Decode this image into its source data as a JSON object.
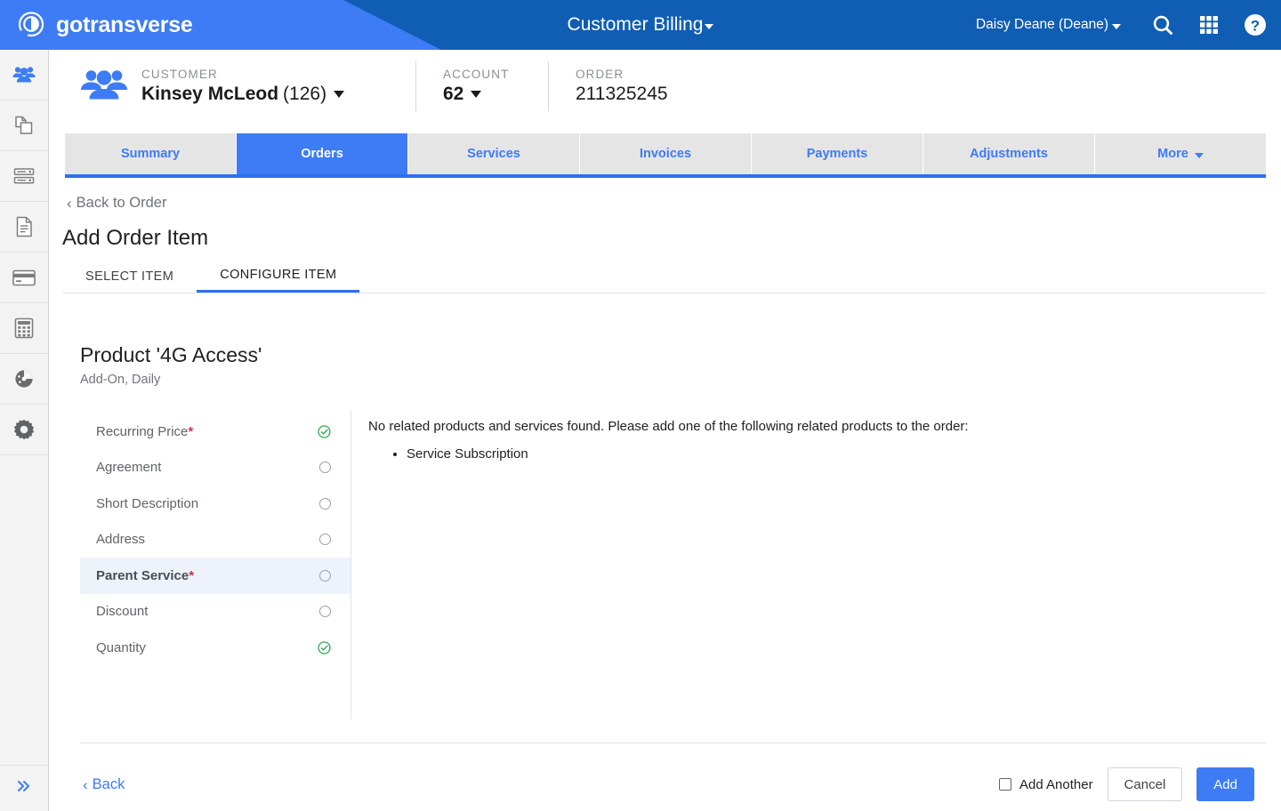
{
  "topbar": {
    "brand": "gotransverse",
    "brand_logo_icon": "gotransverse-circle-logo-icon",
    "title": "Customer Billing",
    "user": "Daisy Deane (Deane)",
    "icons": [
      "search-icon",
      "apps-grid-icon",
      "help-circle-icon"
    ],
    "accent_light": "#3d7cf4",
    "accent_dark": "#0f5eb4"
  },
  "rail": {
    "items": [
      {
        "name": "customers",
        "icon": "people-group-icon",
        "active": true
      },
      {
        "name": "products",
        "icon": "copy-pages-icon",
        "active": false
      },
      {
        "name": "catalog",
        "icon": "server-stack-icon",
        "active": false
      },
      {
        "name": "documents",
        "icon": "document-icon",
        "active": false
      },
      {
        "name": "payments",
        "icon": "credit-card-icon",
        "active": false
      },
      {
        "name": "billing",
        "icon": "calculator-icon",
        "active": false
      },
      {
        "name": "reports",
        "icon": "gauge-dashboard-icon",
        "active": false
      },
      {
        "name": "settings",
        "icon": "gear-icon",
        "active": false
      }
    ],
    "collapse_icon": "double-chevron-right-icon"
  },
  "context": {
    "avatar_icon": "people-group-icon",
    "customer_label": "CUSTOMER",
    "customer_name": "Kinsey McLeod",
    "customer_id": "(126)",
    "account_label": "ACCOUNT",
    "account_value": "62",
    "order_label": "ORDER",
    "order_value": "211325245"
  },
  "tabs": [
    {
      "label": "Summary",
      "active": false,
      "caret": false
    },
    {
      "label": "Orders",
      "active": true,
      "caret": false
    },
    {
      "label": "Services",
      "active": false,
      "caret": false
    },
    {
      "label": "Invoices",
      "active": false,
      "caret": false
    },
    {
      "label": "Payments",
      "active": false,
      "caret": false
    },
    {
      "label": "Adjustments",
      "active": false,
      "caret": false
    },
    {
      "label": "More",
      "active": false,
      "caret": true
    }
  ],
  "page": {
    "back_to_order": "Back to Order",
    "title": "Add Order Item",
    "subtabs": [
      {
        "label": "SELECT ITEM",
        "active": false
      },
      {
        "label": "CONFIGURE ITEM",
        "active": true
      }
    ],
    "product_title": "Product '4G Access'",
    "product_subtitle": "Add-On, Daily"
  },
  "config_items": [
    {
      "label": "Recurring Price",
      "required": true,
      "status": "complete",
      "selected": false
    },
    {
      "label": "Agreement",
      "required": false,
      "status": "empty",
      "selected": false
    },
    {
      "label": "Short Description",
      "required": false,
      "status": "empty",
      "selected": false
    },
    {
      "label": "Address",
      "required": false,
      "status": "empty",
      "selected": false
    },
    {
      "label": "Parent Service",
      "required": true,
      "status": "empty",
      "selected": true
    },
    {
      "label": "Discount",
      "required": false,
      "status": "empty",
      "selected": false
    },
    {
      "label": "Quantity",
      "required": false,
      "status": "complete",
      "selected": false
    }
  ],
  "detail": {
    "message": "No related products and services found. Please add one of the following related products to the order:",
    "related_products": [
      "Service Subscription"
    ]
  },
  "footer": {
    "back_label": "Back",
    "add_another_label": "Add Another",
    "add_another_checked": false,
    "cancel_label": "Cancel",
    "add_label": "Add"
  },
  "colors": {
    "blue": "#3d7cf4",
    "dark_blue": "#0f5eb4",
    "green_ok": "#34a853",
    "required_red": "#d32f47",
    "selected_row": "#eef3fb"
  }
}
